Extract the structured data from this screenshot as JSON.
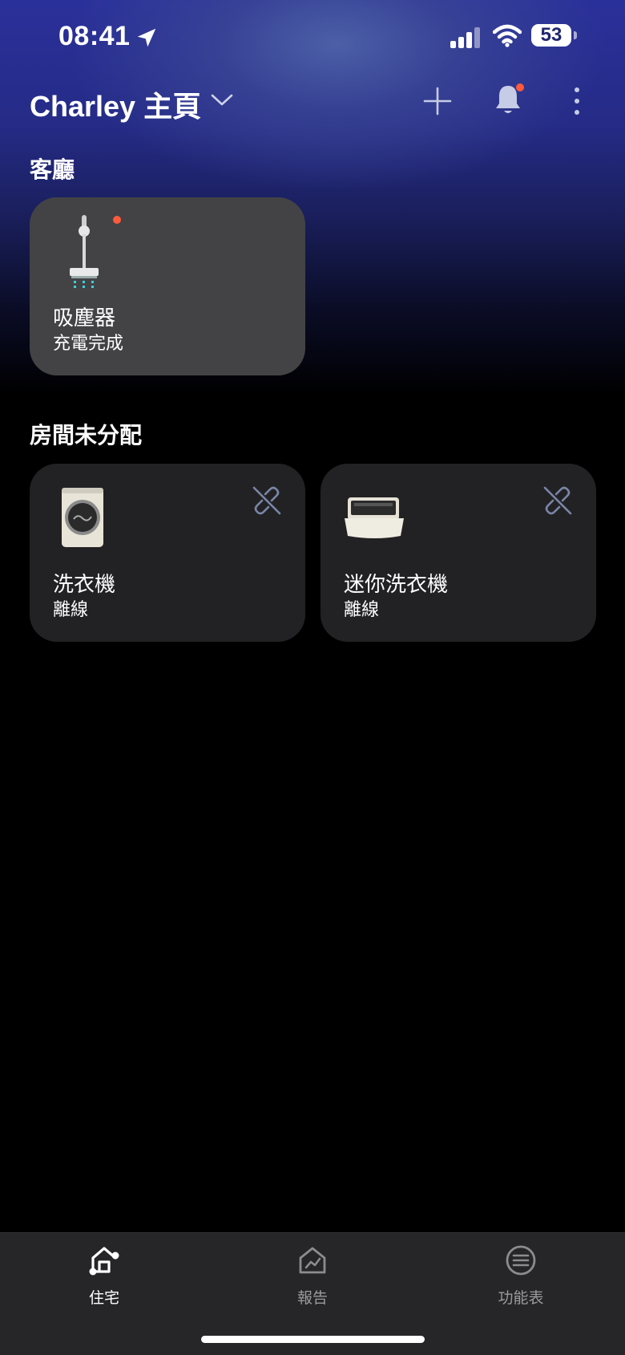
{
  "status_bar": {
    "time": "08:41",
    "battery": "53"
  },
  "header": {
    "home_name": "Charley 主頁"
  },
  "sections": [
    {
      "title": "客廳",
      "devices": [
        {
          "name": "吸塵器",
          "state": "充電完成",
          "icon": "vacuum-icon",
          "alert": true
        }
      ]
    },
    {
      "title": "房間未分配",
      "devices": [
        {
          "name": "洗衣機",
          "state": "離線",
          "icon": "washer-icon",
          "offline": true
        },
        {
          "name": "迷你洗衣機",
          "state": "離線",
          "icon": "mini-washer-icon",
          "offline": true
        }
      ]
    }
  ],
  "tabs": [
    {
      "label": "住宅",
      "icon": "home-icon",
      "active": true
    },
    {
      "label": "報告",
      "icon": "report-icon",
      "active": false
    },
    {
      "label": "功能表",
      "icon": "menu-icon",
      "active": false
    }
  ],
  "colors": {
    "alert_dot": "#ff5a3c",
    "card_active": "#434345",
    "card": "#222224",
    "tabbar": "#262628"
  }
}
